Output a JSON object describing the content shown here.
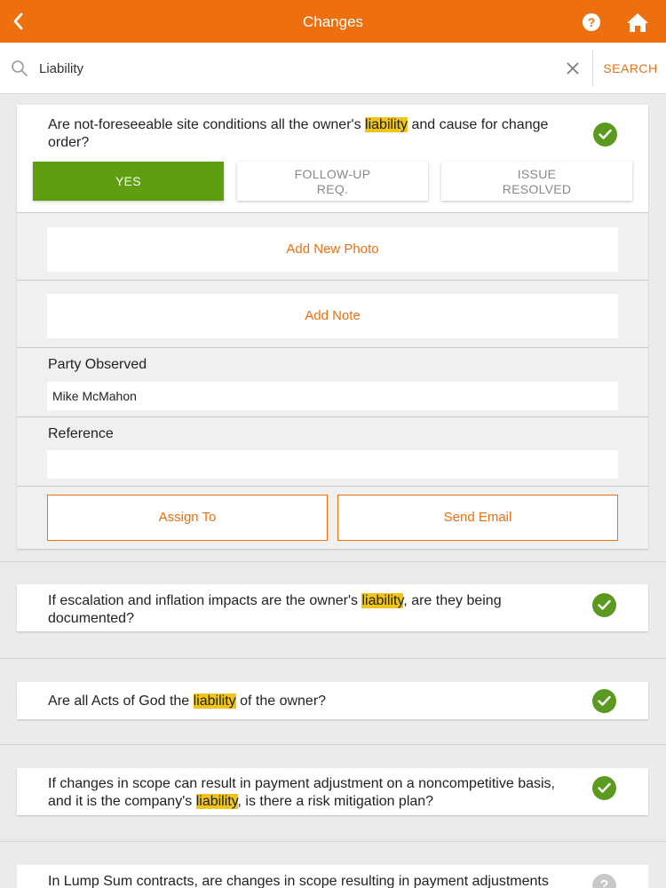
{
  "header": {
    "title": "Changes"
  },
  "search": {
    "value": "Liability",
    "button_label": "SEARCH"
  },
  "expanded_question": {
    "text_before": "Are not-foreseeable site conditions all the owner's ",
    "highlight": "liability",
    "text_after": " and cause for change order?",
    "status": "completed",
    "options": [
      {
        "line1": "YES",
        "line2": "",
        "selected": true
      },
      {
        "line1": "FOLLOW-UP",
        "line2": "REQ.",
        "selected": false
      },
      {
        "line1": "ISSUE",
        "line2": "RESOLVED",
        "selected": false
      }
    ],
    "add_photo_label": "Add New Photo",
    "add_note_label": "Add Note",
    "party_observed_label": "Party Observed",
    "party_observed_value": "Mike McMahon",
    "reference_label": "Reference",
    "reference_value": "",
    "assign_label": "Assign To",
    "email_label": "Send Email"
  },
  "questions": [
    {
      "text_before": "If escalation and inflation impacts are the owner's ",
      "highlight": "liability",
      "text_after": ", are they being documented?",
      "status": "completed"
    },
    {
      "text_before": "Are all Acts of God the ",
      "highlight": "liability",
      "text_after": " of the owner?",
      "status": "completed"
    },
    {
      "text_before": "If changes in scope can result in payment adjustment on a noncompetitive basis, and it is the company's ",
      "highlight": "liability",
      "text_after": ", is there a risk mitigation plan?",
      "status": "completed"
    },
    {
      "text_before": "In Lump Sum contracts, are changes in scope resulting in payment adjustments",
      "highlight": "",
      "text_after": "",
      "status": "pending"
    }
  ],
  "colors": {
    "brand": "#ee6f10",
    "yes": "#5f9e10",
    "check": "#5a9a1f",
    "highlight": "#f0c419"
  },
  "icons": [
    "back-arrow-icon",
    "help-icon",
    "home-icon",
    "search-icon",
    "clear-icon",
    "checkmark-icon",
    "question-icon"
  ]
}
